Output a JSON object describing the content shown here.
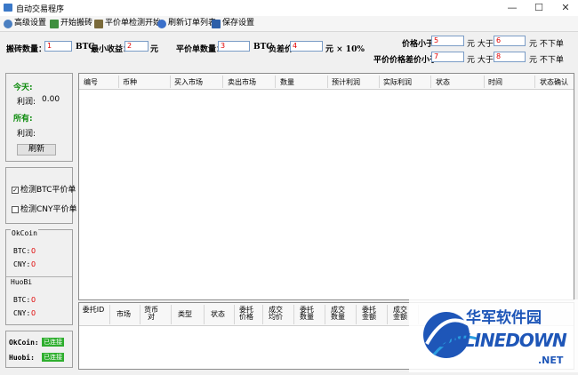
{
  "window": {
    "title": "自动交易程序",
    "minimize": "—",
    "maximize": "☐",
    "close": "✕"
  },
  "toolbar": [
    {
      "label": "高级设置",
      "icon": "gear-icon",
      "color": "#4a7fc1"
    },
    {
      "label": "开始搬砖",
      "icon": "grid-icon",
      "color": "#3f8f3f"
    },
    {
      "label": "平价单检测开始",
      "icon": "list-check-icon",
      "color": "#7a6a3a"
    },
    {
      "label": "刷新订单列表",
      "icon": "refresh-icon",
      "color": "#3a6fc9"
    },
    {
      "label": "保存设置",
      "icon": "save-icon",
      "color": "#2d5fa8"
    }
  ],
  "params": {
    "brick_amount_label": "搬砖数量：",
    "brick_amount_value": "1",
    "btc_unit1": "BTC",
    "min_profit_label": "最小收益：",
    "min_profit_value": "2",
    "yuan1": "元",
    "flat_amount_label": "平价单数量：",
    "flat_amount_value": "3",
    "btc_unit2": "BTC",
    "neg_diff_label": "负差价:",
    "neg_diff_value": "4",
    "neg_diff_suffix": "元 × 10%",
    "price_below_label": "价格小于",
    "price_below_value": "5",
    "yuan_greater1": "元  大于",
    "price_above_value": "6",
    "no_order1": "元  不下单",
    "diff_below_label": "平价价格差价小于",
    "diff_below_value": "7",
    "yuan_greater2": "元  大于",
    "diff_above_value": "8",
    "no_order2": "元  不下单"
  },
  "stats": {
    "today_label": "今天:",
    "today_profit_label": "利润:",
    "today_profit_value": "0.00",
    "all_label": "所有:",
    "all_profit_label": "利润:",
    "refresh_button": "刷新"
  },
  "checks": {
    "btc_label": "检测BTC平价单",
    "btc_checked": true,
    "btc_mark": "✓",
    "cny_label": "检测CNY平价单",
    "cny_checked": false
  },
  "balances": {
    "okcoin_label": "OkCoin",
    "okcoin_btc_label": "BTC:",
    "okcoin_btc_value": "0",
    "okcoin_cny_label": "CNY:",
    "okcoin_cny_value": "0",
    "huobi_label": "HuoBi",
    "huobi_btc_label": "BTC:",
    "huobi_btc_value": "0",
    "huobi_cny_label": "CNY:",
    "huobi_cny_value": "0"
  },
  "connection": {
    "okcoin_label": "OkCoin:",
    "okcoin_status": "已连接",
    "huobi_label": "Huobi:",
    "huobi_status": "已连接"
  },
  "orders_table": {
    "columns": [
      "编号",
      "币种",
      "买入市场",
      "卖出市场",
      "数量",
      "预计利润",
      "实际利润",
      "状态",
      "时间",
      "状态确认"
    ]
  },
  "delegation_table": {
    "columns": [
      "委托ID",
      "市场",
      "货币对",
      "类型",
      "状态",
      "委托价格",
      "成交均价",
      "委托数量",
      "成交数量",
      "委托金额",
      "成交金额"
    ]
  },
  "watermark": {
    "line1": "华军软件园",
    "line2": "ONLINEDOWN",
    "suffix": ".NET"
  }
}
